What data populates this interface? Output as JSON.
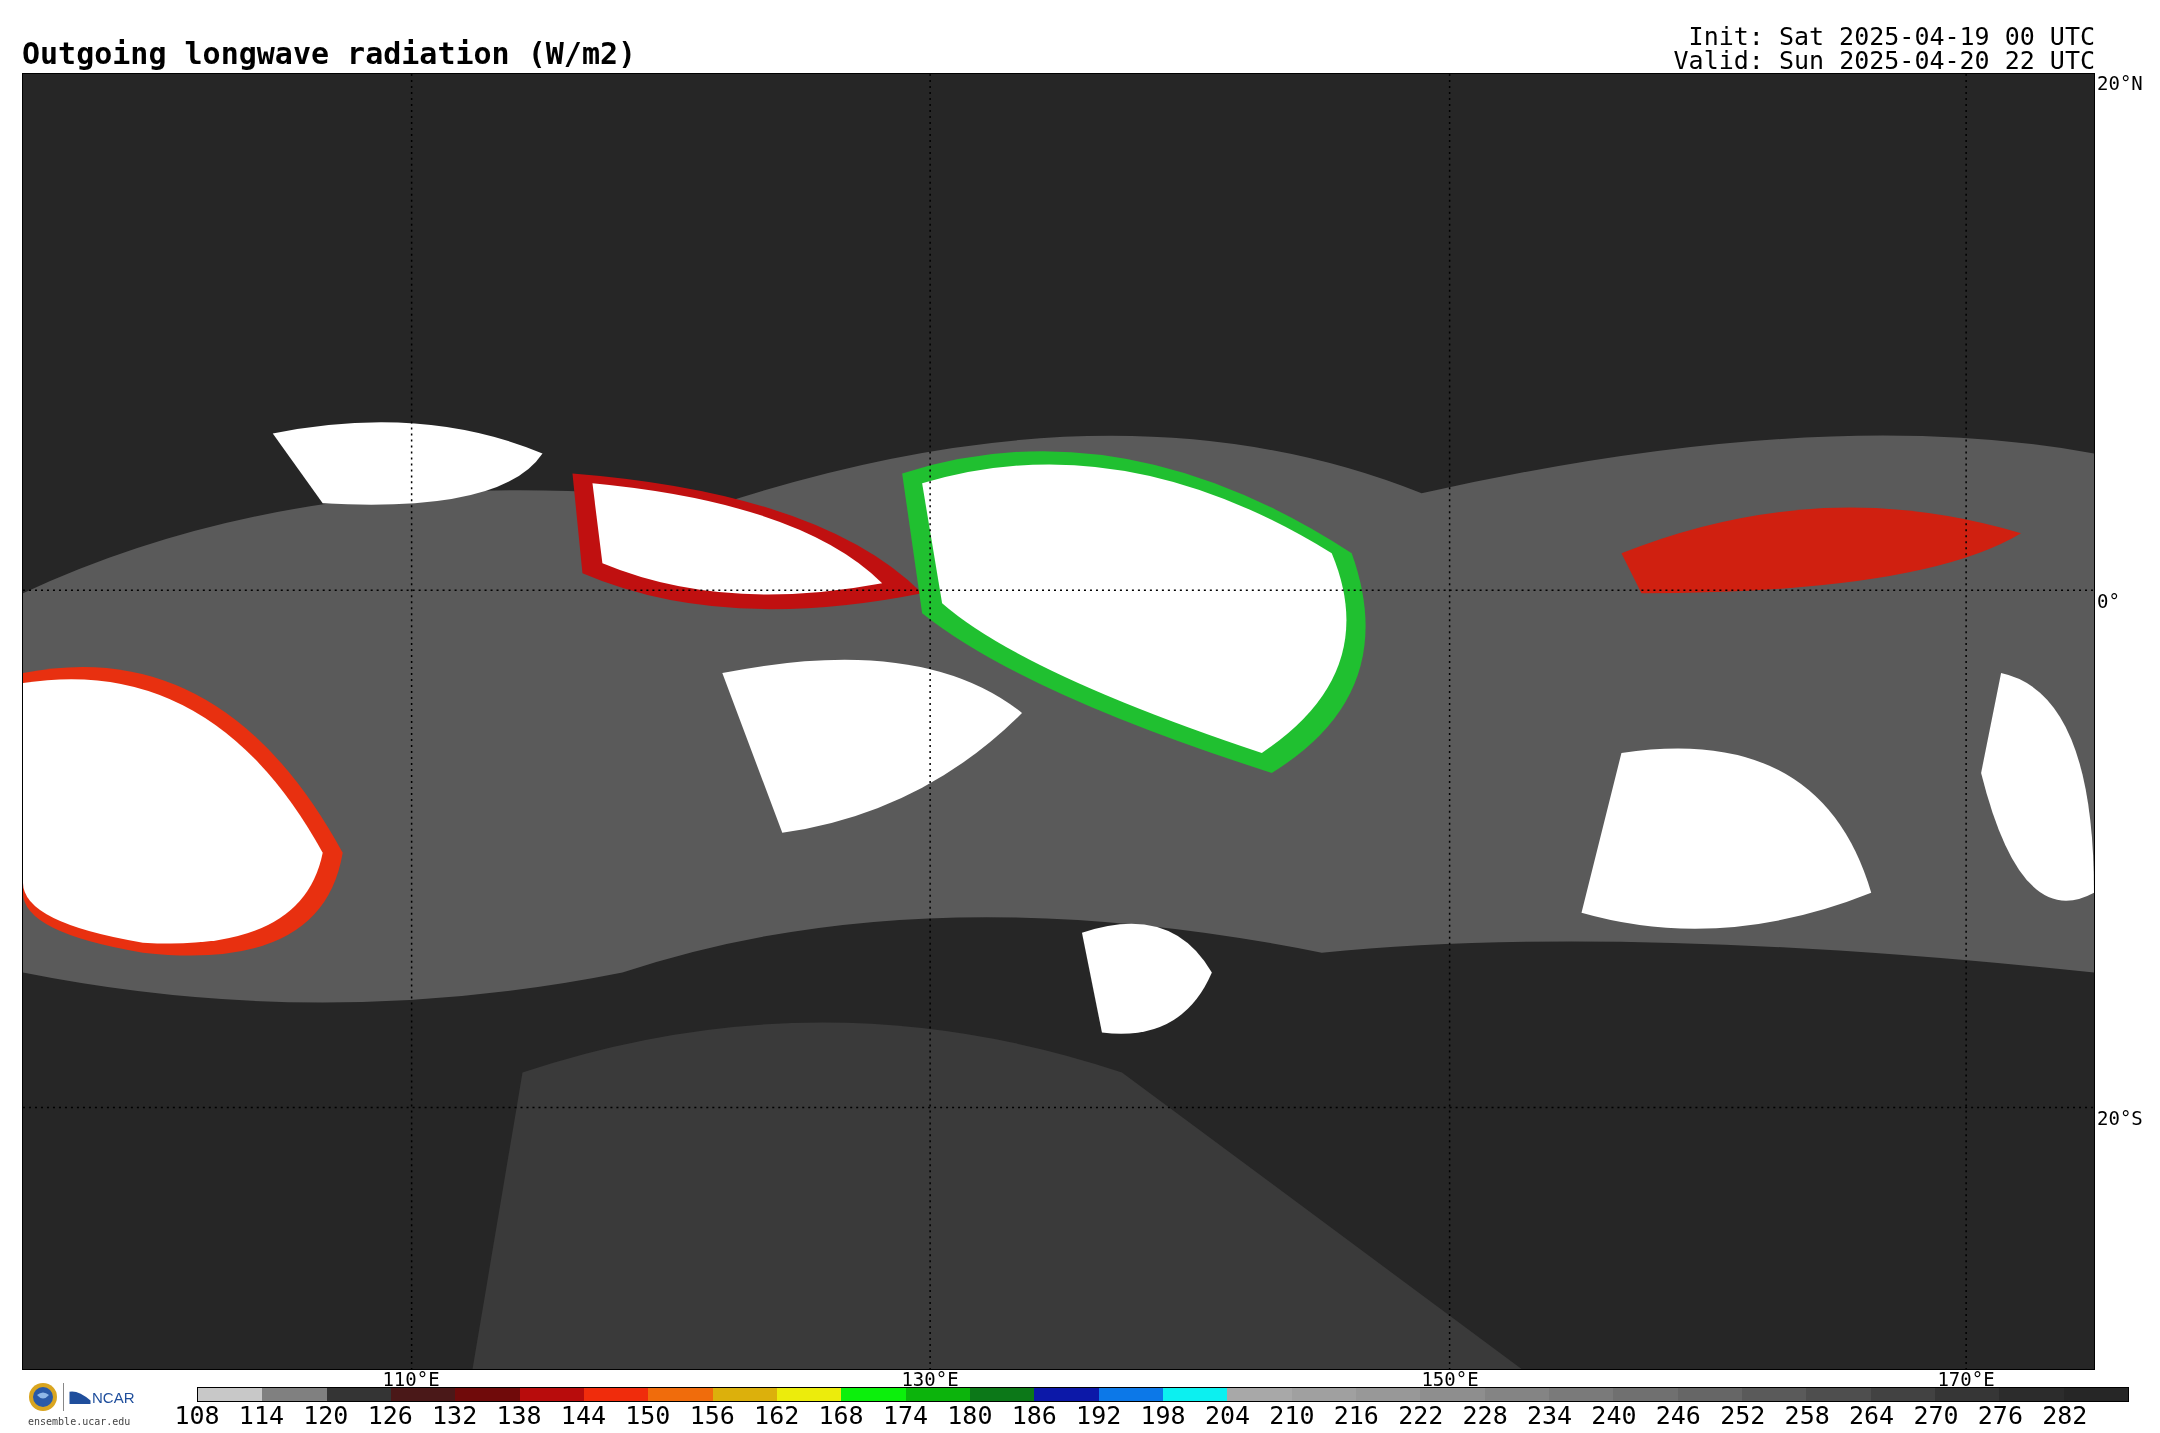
{
  "title": "Outgoing longwave radiation (W/m2)",
  "init": "Init: Sat 2025-04-19 00 UTC",
  "valid": "Valid: Sun 2025-04-20 22 UTC",
  "map": {
    "lat_labels": [
      "20°N",
      "0°",
      "20°S"
    ],
    "lon_labels": [
      "110°E",
      "130°E",
      "150°E",
      "170°E"
    ]
  },
  "logo": {
    "name": "NCAR",
    "site": "ensemble.ucar.edu"
  },
  "colorbar": {
    "labels": [
      "108",
      "114",
      "120",
      "126",
      "132",
      "138",
      "144",
      "150",
      "156",
      "162",
      "168",
      "174",
      "180",
      "186",
      "192",
      "198",
      "204",
      "210",
      "216",
      "222",
      "228",
      "234",
      "240",
      "246",
      "252",
      "258",
      "264",
      "270",
      "276",
      "282"
    ],
    "bins": [
      {
        "color": "#c8c8c8"
      },
      {
        "color": "#808080"
      },
      {
        "color": "#343434"
      },
      {
        "color": "#4a1818"
      },
      {
        "color": "#700a0a"
      },
      {
        "color": "#b80c0c"
      },
      {
        "color": "#f02c0c"
      },
      {
        "color": "#f06c0c"
      },
      {
        "color": "#dcb00c"
      },
      {
        "color": "#ecec0c"
      },
      {
        "color": "#0cf00c"
      },
      {
        "color": "#0cb40c"
      },
      {
        "color": "#0c7818"
      },
      {
        "color": "#0c18a8"
      },
      {
        "color": "#0c78e8"
      },
      {
        "color": "#0cf0f0"
      },
      {
        "color": "#a8a8a8"
      },
      {
        "color": "#a0a0a0"
      },
      {
        "color": "#989898"
      },
      {
        "color": "#8e8e8e"
      },
      {
        "color": "#848484"
      },
      {
        "color": "#7a7a7a"
      },
      {
        "color": "#707070"
      },
      {
        "color": "#666666"
      },
      {
        "color": "#5a5a5a"
      },
      {
        "color": "#4e4e4e"
      },
      {
        "color": "#424242"
      },
      {
        "color": "#363636"
      },
      {
        "color": "#2c2c2c"
      },
      {
        "color": "#262626"
      }
    ]
  }
}
